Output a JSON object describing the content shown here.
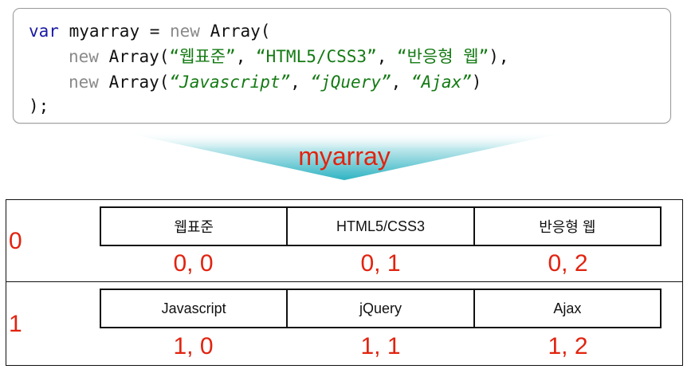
{
  "code": {
    "line1": {
      "kw": "var",
      "rest": " myarray = ",
      "kw2": "new",
      "tail": " Array("
    },
    "line2": {
      "kw2": "new",
      "mid": " Array(",
      "s1": "“웹표준”",
      "c1": ", ",
      "s2": "“HTML5/CSS3”",
      "c2": ", ",
      "s3": "“반응형 웹”",
      "end": "),"
    },
    "line3": {
      "kw2": "new",
      "mid": " Array(",
      "s1": "“Javascript”",
      "c1": ", ",
      "s2": "“jQuery”",
      "c2": ", ",
      "s3": "“Ajax”",
      "end": ")"
    },
    "line4": ");"
  },
  "array_label": "myarray",
  "rows": [
    {
      "index": "0",
      "cells": [
        "웹표준",
        "HTML5/CSS3",
        "반응형 웹"
      ],
      "indices": [
        "0, 0",
        "0, 1",
        "0, 2"
      ]
    },
    {
      "index": "1",
      "cells": [
        "Javascript",
        "jQuery",
        "Ajax"
      ],
      "indices": [
        "1, 0",
        "1, 1",
        "1, 2"
      ]
    }
  ],
  "colors": {
    "accent_red": "#e1230f",
    "funnel_teal": "#33b6c4",
    "keyword_blue": "#1a1aa6",
    "string_green": "#137a13"
  }
}
